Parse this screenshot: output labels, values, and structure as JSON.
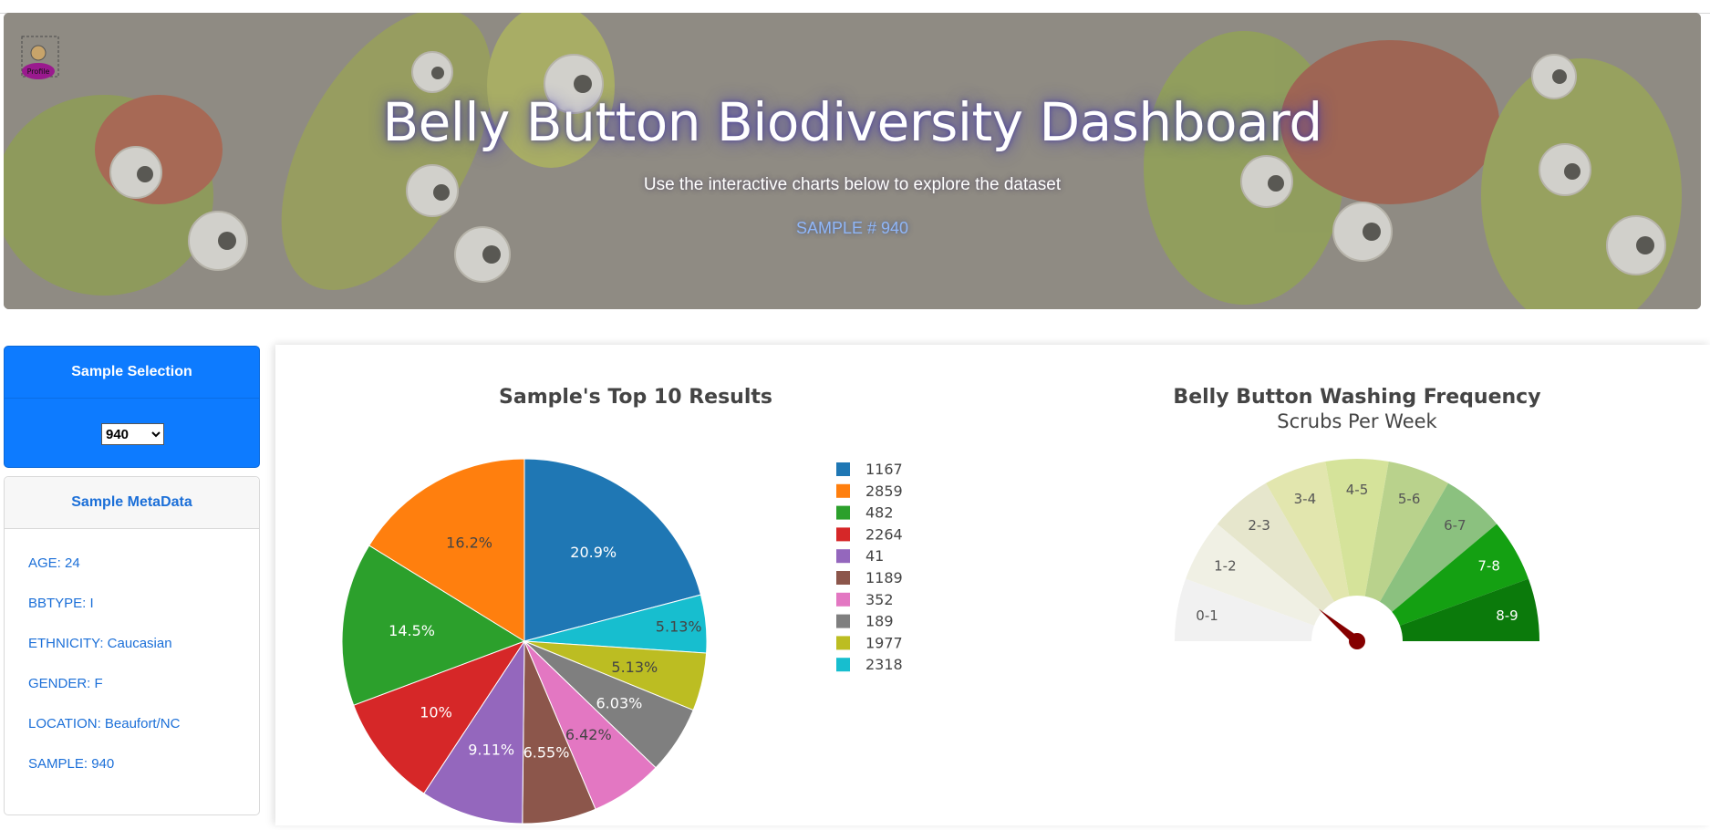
{
  "header": {
    "title": "Belly Button Biodiversity Dashboard",
    "subtitle": "Use the interactive charts below to explore the dataset",
    "sample_label": "SAMPLE # 940",
    "profile_icon_label": "Profile"
  },
  "sidebar": {
    "selection_title": "Sample Selection",
    "selected_sample": "940",
    "metadata_title": "Sample MetaData",
    "metadata": [
      "AGE: 24",
      "BBTYPE: I",
      "ETHNICITY: Caucasian",
      "GENDER: F",
      "LOCATION: Beaufort/NC",
      "SAMPLE: 940"
    ]
  },
  "chart_data": [
    {
      "type": "pie",
      "title": "Sample's Top 10 Results",
      "labels": [
        "1167",
        "2859",
        "482",
        "2264",
        "41",
        "1189",
        "352",
        "189",
        "1977",
        "2318"
      ],
      "values": [
        20.9,
        16.2,
        14.5,
        10.0,
        9.11,
        6.55,
        6.42,
        6.03,
        5.13,
        5.13
      ],
      "value_labels": [
        "20.9%",
        "16.2%",
        "14.5%",
        "10%",
        "9.11%",
        "6.55%",
        "6.42%",
        "6.03%",
        "5.13%",
        "5.13%"
      ],
      "colors": [
        "#1f77b4",
        "#ff7f0e",
        "#2ca02c",
        "#d62728",
        "#9467bd",
        "#8c564b",
        "#e377c2",
        "#7f7f7f",
        "#bcbd22",
        "#17becf"
      ],
      "legend_position": "right"
    },
    {
      "type": "gauge",
      "title": "Belly Button Washing Frequency",
      "subtitle": "Scrubs Per Week",
      "categories": [
        "0-1",
        "1-2",
        "2-3",
        "3-4",
        "4-5",
        "5-6",
        "6-7",
        "7-8",
        "8-9"
      ],
      "colors": [
        "#f1f1f1",
        "#f0f0e4",
        "#e6e6cc",
        "#e2e6ae",
        "#d5e39a",
        "#b9d28c",
        "#8bc17f",
        "#14a012",
        "#0b7a0b"
      ],
      "range": [
        0,
        9
      ],
      "value": 2
    }
  ]
}
